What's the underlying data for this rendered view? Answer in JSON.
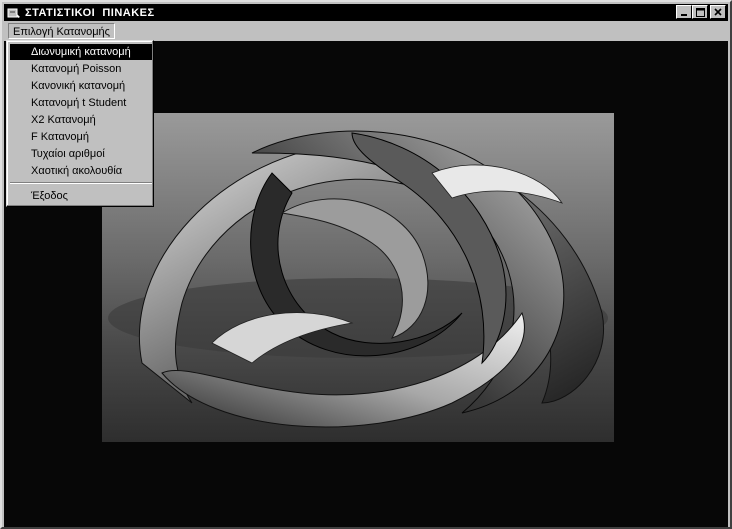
{
  "window": {
    "title": "ΣΤΑΤΙΣΤΙΚΟΙ  ΠΙΝΑΚΕΣ"
  },
  "menubar": {
    "menu_label": "Επιλογή Κατανομής"
  },
  "menu": {
    "items": [
      {
        "label": "Διωνυμική κατανομή",
        "selected": true
      },
      {
        "label": "Κατανομή Poisson"
      },
      {
        "label": "Κανονική κατανομή"
      },
      {
        "label": "Κατανομή t Student"
      },
      {
        "label": "X2 Κατανομή"
      },
      {
        "label": "F Κατανομή"
      },
      {
        "label": "Τυχαίοι αριθμοί"
      },
      {
        "label": "Χαοτική ακολουθία"
      }
    ],
    "exit_label": "Έξοδος"
  },
  "colors": {
    "titlebar": "#000000",
    "face": "#c0c0c0",
    "client": "#070707",
    "highlight": "#000000"
  }
}
